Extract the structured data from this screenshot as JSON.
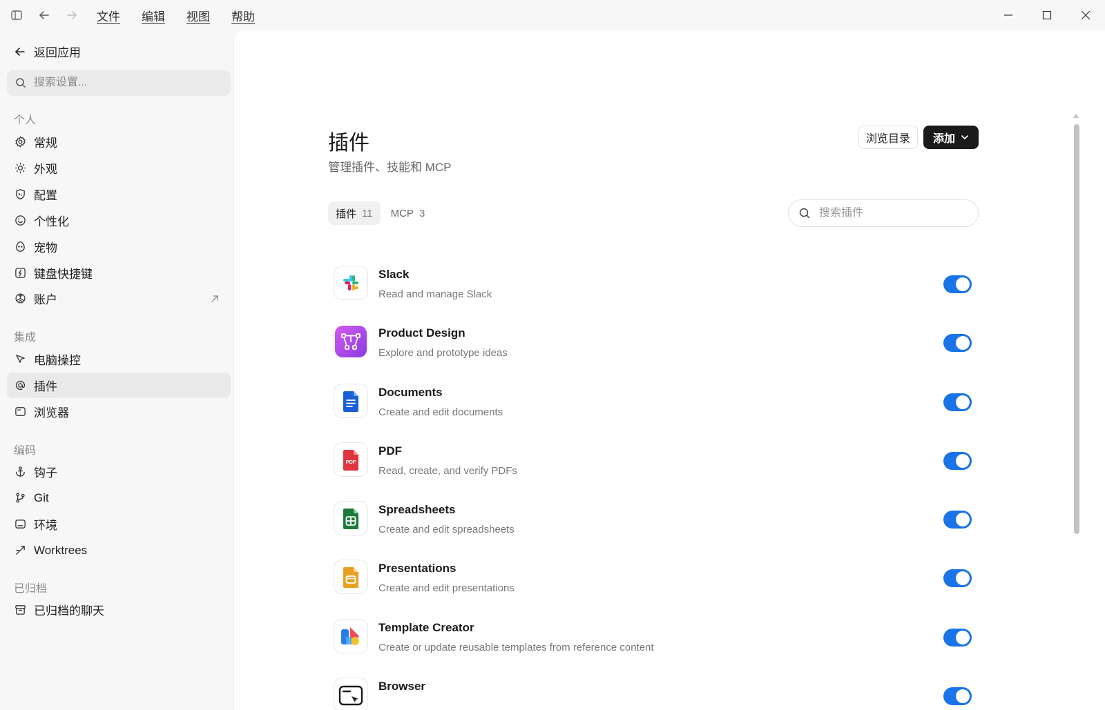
{
  "menu": {
    "items": [
      "文件",
      "编辑",
      "视图",
      "帮助"
    ]
  },
  "sidebar": {
    "back_label": "返回应用",
    "search_placeholder": "搜索设置...",
    "sections": {
      "personal": "个人",
      "integration": "集成",
      "coding": "编码",
      "archived": "已归档"
    },
    "items": {
      "general": "常规",
      "appearance": "外观",
      "config": "配置",
      "personalize": "个性化",
      "pets": "宠物",
      "shortcuts": "键盘快捷键",
      "account": "账户",
      "computer_control": "电脑操控",
      "plugins": "插件",
      "browser": "浏览器",
      "hooks": "钩子",
      "git": "Git",
      "env": "环境",
      "worktrees": "Worktrees",
      "archived_chats": "已归档的聊天"
    }
  },
  "main": {
    "title": "插件",
    "subtitle": "管理插件、技能和 MCP",
    "browse_label": "浏览目录",
    "add_label": "添加",
    "tabs": [
      {
        "label": "插件",
        "count": "11"
      },
      {
        "label": "MCP",
        "count": "3"
      }
    ],
    "search_placeholder": "搜索插件",
    "plugins": [
      {
        "name": "Slack",
        "desc": "Read and manage Slack",
        "enabled": true
      },
      {
        "name": "Product Design",
        "desc": "Explore and prototype ideas",
        "enabled": true
      },
      {
        "name": "Documents",
        "desc": "Create and edit documents",
        "enabled": true
      },
      {
        "name": "PDF",
        "desc": "Read, create, and verify PDFs",
        "enabled": true,
        "icon_text": "PDF"
      },
      {
        "name": "Spreadsheets",
        "desc": "Create and edit spreadsheets",
        "enabled": true
      },
      {
        "name": "Presentations",
        "desc": "Create and edit presentations",
        "enabled": true
      },
      {
        "name": "Template Creator",
        "desc": "Create or update reusable templates from reference content",
        "enabled": true
      },
      {
        "name": "Browser",
        "desc": "",
        "enabled": true
      }
    ]
  },
  "colors": {
    "accent": "#1a73e8",
    "add_button_bg": "#1a1a1a"
  }
}
